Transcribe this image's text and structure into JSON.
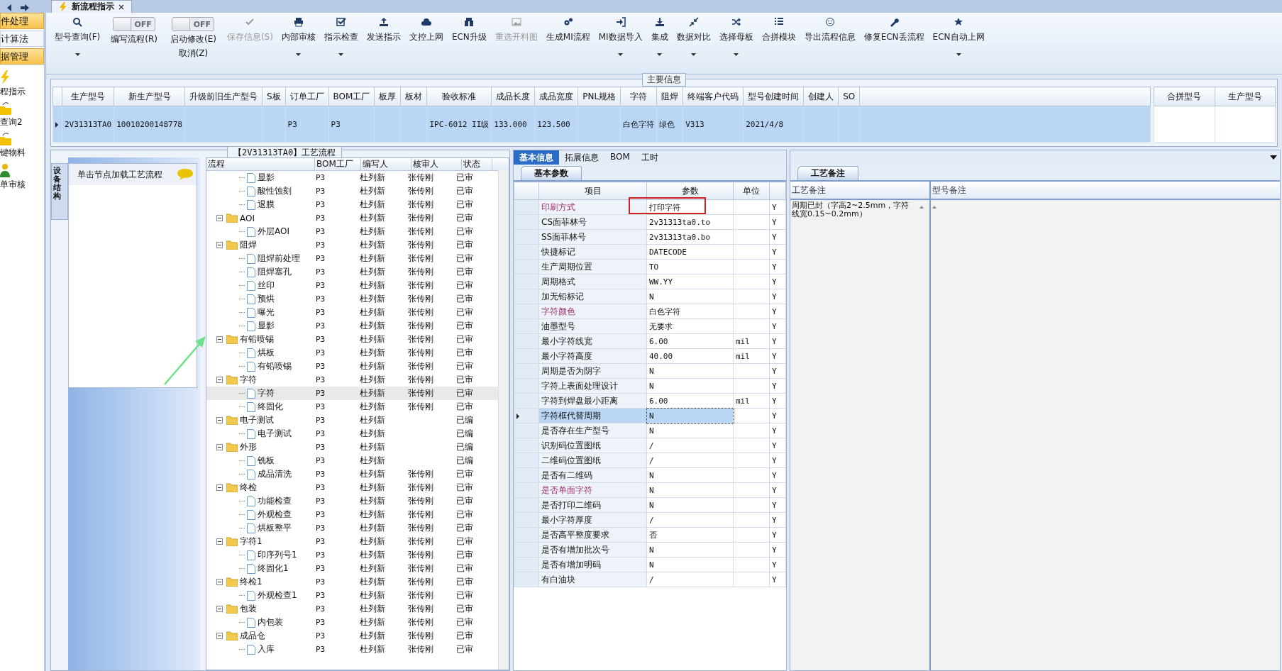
{
  "doc_tab": {
    "title": "新流程指示"
  },
  "sidebar": {
    "items": [
      {
        "label": "件处理",
        "kind": "menu",
        "selected": true
      },
      {
        "label": "计算法",
        "kind": "menu",
        "selected": false
      },
      {
        "label": "据管理",
        "kind": "menu",
        "selected": true
      },
      {
        "label": "程指示",
        "kind": "icon",
        "selected": false
      },
      {
        "label": "查询2",
        "kind": "icon",
        "selected": false
      },
      {
        "label": "键物料",
        "kind": "icon",
        "selected": false
      },
      {
        "label": "单审核",
        "kind": "icon",
        "selected": false
      }
    ]
  },
  "toolbar": [
    {
      "kind": "button",
      "label": "型号查询(F)",
      "dropdown": true,
      "disabled": false
    },
    {
      "kind": "toggle",
      "label": "编写流程(R)",
      "state_text": "OFF",
      "on": false
    },
    {
      "kind": "toggle",
      "label": "启动修改(E)",
      "label2": "取消(Z)",
      "state_text": "OFF",
      "on": false
    },
    {
      "kind": "button",
      "label": "保存信息(S)",
      "dropdown": false,
      "disabled": true
    },
    {
      "kind": "button",
      "label": "内部审核",
      "dropdown": true,
      "disabled": false
    },
    {
      "kind": "button",
      "label": "指示检查",
      "dropdown": true,
      "disabled": false
    },
    {
      "kind": "button",
      "label": "发送指示",
      "dropdown": false,
      "disabled": false
    },
    {
      "kind": "button",
      "label": "文控上网",
      "dropdown": false,
      "disabled": false
    },
    {
      "kind": "button",
      "label": "ECN升级",
      "dropdown": false,
      "disabled": false
    },
    {
      "kind": "button",
      "label": "重选开料图",
      "dropdown": false,
      "disabled": true
    },
    {
      "kind": "button",
      "label": "生成MI流程",
      "dropdown": false,
      "disabled": false
    },
    {
      "kind": "button",
      "label": "MI数据导入",
      "dropdown": true,
      "disabled": false
    },
    {
      "kind": "button",
      "label": "集成",
      "dropdown": true,
      "disabled": false
    },
    {
      "kind": "button",
      "label": "数据对比",
      "dropdown": true,
      "disabled": false
    },
    {
      "kind": "button",
      "label": "选择母板",
      "dropdown": true,
      "disabled": false
    },
    {
      "kind": "button",
      "label": "合拼模块",
      "dropdown": false,
      "disabled": false
    },
    {
      "kind": "button",
      "label": "导出流程信息",
      "dropdown": false,
      "disabled": false
    },
    {
      "kind": "button",
      "label": "修复ECN丢流程",
      "dropdown": false,
      "disabled": false
    },
    {
      "kind": "button",
      "label": "ECN自动上网",
      "dropdown": true,
      "disabled": false
    }
  ],
  "main_info": {
    "title": "主要信息",
    "columns": [
      "生产型号",
      "新生产型号",
      "升级前旧生产型号",
      "S板",
      "订单工厂",
      "BOM工厂",
      "板厚",
      "板材",
      "验收标准",
      "成品长度",
      "成品宽度",
      "PNL规格",
      "字符",
      "阻焊",
      "终端客户代码",
      "型号创建时间",
      "创建人",
      "SO"
    ],
    "rows": [
      {
        "selected": true,
        "cells": [
          "2V31313TA0",
          "10010200148778",
          "",
          "",
          "P3",
          "P3",
          "",
          "",
          "IPC-6012 II级",
          "133.000",
          "123.500",
          "",
          "白色字符",
          "绿色",
          "V313",
          "2021/4/8",
          "",
          ""
        ]
      }
    ],
    "side_columns": [
      "合拼型号",
      "生产型号"
    ]
  },
  "process": {
    "title": "【2V31313TA0】工艺流程",
    "side_tab": "设备结构",
    "hint": "单击节点加载工艺流程",
    "columns": [
      "流程",
      "BOM工厂",
      "编写人",
      "核审人",
      "状态"
    ],
    "tree": [
      {
        "children": [
          {
            "label": "显影",
            "bom": "P3",
            "writer": "杜列新",
            "reviewer": "张传刚",
            "status": "已审",
            "selected": false
          },
          {
            "label": "酸性蚀刻",
            "bom": "P3",
            "writer": "杜列新",
            "reviewer": "张传刚",
            "status": "已审",
            "selected": false
          },
          {
            "label": "退膜",
            "bom": "P3",
            "writer": "杜列新",
            "reviewer": "张传刚",
            "status": "已审",
            "selected": false
          }
        ]
      },
      {
        "label": "AOI",
        "bom": "P3",
        "writer": "杜列新",
        "reviewer": "张传刚",
        "status": "已审",
        "expanded": true,
        "selected": false,
        "children": [
          {
            "label": "外层AOI",
            "bom": "P3",
            "writer": "杜列新",
            "reviewer": "张传刚",
            "status": "已审",
            "selected": false
          }
        ]
      },
      {
        "label": "阻焊",
        "bom": "P3",
        "writer": "杜列新",
        "reviewer": "张传刚",
        "status": "已审",
        "expanded": true,
        "selected": false,
        "children": [
          {
            "label": "阻焊前处理",
            "bom": "P3",
            "writer": "杜列新",
            "reviewer": "张传刚",
            "status": "已审",
            "selected": false
          },
          {
            "label": "阻焊塞孔",
            "bom": "P3",
            "writer": "杜列新",
            "reviewer": "张传刚",
            "status": "已审",
            "selected": false
          },
          {
            "label": "丝印",
            "bom": "P3",
            "writer": "杜列新",
            "reviewer": "张传刚",
            "status": "已审",
            "selected": false
          },
          {
            "label": "预烘",
            "bom": "P3",
            "writer": "杜列新",
            "reviewer": "张传刚",
            "status": "已审",
            "selected": false
          },
          {
            "label": "曝光",
            "bom": "P3",
            "writer": "杜列新",
            "reviewer": "张传刚",
            "status": "已审",
            "selected": false
          },
          {
            "label": "显影",
            "bom": "P3",
            "writer": "杜列新",
            "reviewer": "张传刚",
            "status": "已审",
            "selected": false
          }
        ]
      },
      {
        "label": "有铅喷锡",
        "bom": "P3",
        "writer": "杜列新",
        "reviewer": "张传刚",
        "status": "已审",
        "expanded": true,
        "selected": false,
        "children": [
          {
            "label": "烘板",
            "bom": "P3",
            "writer": "杜列新",
            "reviewer": "张传刚",
            "status": "已审",
            "selected": false
          },
          {
            "label": "有铅喷锡",
            "bom": "P3",
            "writer": "杜列新",
            "reviewer": "张传刚",
            "status": "已审",
            "selected": false
          }
        ]
      },
      {
        "label": "字符",
        "bom": "P3",
        "writer": "杜列新",
        "reviewer": "张传刚",
        "status": "已审",
        "expanded": true,
        "selected": false,
        "children": [
          {
            "label": "字符",
            "bom": "P3",
            "writer": "杜列新",
            "reviewer": "张传刚",
            "status": "已审",
            "selected": true
          },
          {
            "label": "终固化",
            "bom": "P3",
            "writer": "杜列新",
            "reviewer": "张传刚",
            "status": "已审",
            "selected": false
          }
        ]
      },
      {
        "label": "电子测试",
        "bom": "P3",
        "writer": "杜列新",
        "status": "已编",
        "expanded": true,
        "selected": false,
        "children": [
          {
            "label": "电子测试",
            "bom": "P3",
            "writer": "杜列新",
            "status": "已编",
            "selected": false
          }
        ]
      },
      {
        "label": "外形",
        "bom": "P3",
        "writer": "杜列新",
        "status": "已编",
        "expanded": true,
        "selected": false,
        "children": [
          {
            "label": "铣板",
            "bom": "P3",
            "writer": "杜列新",
            "status": "已编",
            "selected": false
          },
          {
            "label": "成品清洗",
            "bom": "P3",
            "writer": "杜列新",
            "reviewer": "张传刚",
            "status": "已审",
            "selected": false
          }
        ]
      },
      {
        "label": "终检",
        "bom": "P3",
        "writer": "杜列新",
        "reviewer": "张传刚",
        "status": "已审",
        "expanded": true,
        "selected": false,
        "children": [
          {
            "label": "功能检查",
            "bom": "P3",
            "writer": "杜列新",
            "reviewer": "张传刚",
            "status": "已审",
            "selected": false
          },
          {
            "label": "外观检查",
            "bom": "P3",
            "writer": "杜列新",
            "reviewer": "张传刚",
            "status": "已审",
            "selected": false
          },
          {
            "label": "烘板整平",
            "bom": "P3",
            "writer": "杜列新",
            "reviewer": "张传刚",
            "status": "已审",
            "selected": false
          }
        ]
      },
      {
        "label": "字符1",
        "bom": "P3",
        "writer": "杜列新",
        "reviewer": "张传刚",
        "status": "已审",
        "expanded": true,
        "selected": false,
        "children": [
          {
            "label": "印序列号1",
            "bom": "P3",
            "writer": "杜列新",
            "reviewer": "张传刚",
            "status": "已审",
            "selected": false
          },
          {
            "label": "终固化1",
            "bom": "P3",
            "writer": "杜列新",
            "reviewer": "张传刚",
            "status": "已审",
            "selected": false
          }
        ]
      },
      {
        "label": "终检1",
        "bom": "P3",
        "writer": "杜列新",
        "reviewer": "张传刚",
        "status": "已审",
        "expanded": true,
        "selected": false,
        "children": [
          {
            "label": "外观检查1",
            "bom": "P3",
            "writer": "杜列新",
            "reviewer": "张传刚",
            "status": "已审",
            "selected": false
          }
        ]
      },
      {
        "label": "包装",
        "bom": "P3",
        "writer": "杜列新",
        "reviewer": "张传刚",
        "status": "已审",
        "expanded": true,
        "selected": false,
        "children": [
          {
            "label": "内包装",
            "bom": "P3",
            "writer": "杜列新",
            "reviewer": "张传刚",
            "status": "已审",
            "selected": false
          }
        ]
      },
      {
        "label": "成品仓",
        "bom": "P3",
        "writer": "杜列新",
        "reviewer": "张传刚",
        "status": "已审",
        "expanded": true,
        "selected": false,
        "children": [
          {
            "label": "入库",
            "bom": "P3",
            "writer": "杜列新",
            "reviewer": "张传刚",
            "status": "已审",
            "selected": false
          }
        ]
      }
    ]
  },
  "detail": {
    "tabs": [
      {
        "label": "基本信息",
        "selected": true
      },
      {
        "label": "拓展信息",
        "selected": false
      },
      {
        "label": "BOM",
        "selected": false
      },
      {
        "label": "工时",
        "selected": false
      }
    ],
    "subtab": "基本参数",
    "columns": [
      "项目",
      "参数",
      "单位"
    ],
    "rows": [
      {
        "item": "印刷方式",
        "value": "打印字符",
        "flag": "Y",
        "emphasis": true,
        "boxed": true,
        "selected": false
      },
      {
        "item": "CS面菲林号",
        "value": "2v31313ta0.to",
        "flag": "Y",
        "emphasis": false,
        "boxed": false,
        "selected": false
      },
      {
        "item": "SS面菲林号",
        "value": "2v31313ta0.bo",
        "flag": "Y",
        "emphasis": false,
        "boxed": false,
        "selected": false
      },
      {
        "item": "快捷标记",
        "value": "DATECODE",
        "flag": "Y",
        "emphasis": false,
        "boxed": false,
        "selected": false
      },
      {
        "item": "生产周期位置",
        "value": "TO",
        "flag": "Y",
        "emphasis": false,
        "boxed": false,
        "selected": false
      },
      {
        "item": "周期格式",
        "value": "WW.YY",
        "flag": "Y",
        "emphasis": false,
        "boxed": false,
        "selected": false
      },
      {
        "item": "加无铅标记",
        "value": "N",
        "flag": "Y",
        "emphasis": false,
        "boxed": false,
        "selected": false
      },
      {
        "item": "字符颜色",
        "value": "白色字符",
        "flag": "Y",
        "emphasis": true,
        "boxed": false,
        "selected": false
      },
      {
        "item": "油墨型号",
        "value": "无要求",
        "flag": "Y",
        "emphasis": false,
        "boxed": false,
        "selected": false
      },
      {
        "item": "最小字符线宽",
        "value": "6.00",
        "unit": "mil",
        "flag": "Y",
        "emphasis": false,
        "boxed": false,
        "selected": false
      },
      {
        "item": "最小字符高度",
        "value": "40.00",
        "unit": "mil",
        "flag": "Y",
        "emphasis": false,
        "boxed": false,
        "selected": false
      },
      {
        "item": "周期是否为阴字",
        "value": "N",
        "flag": "Y",
        "emphasis": false,
        "boxed": false,
        "selected": false
      },
      {
        "item": "字符上表面处理设计",
        "value": "N",
        "flag": "Y",
        "emphasis": false,
        "boxed": false,
        "selected": false
      },
      {
        "item": "字符到焊盘最小距离",
        "value": "6.00",
        "unit": "mil",
        "flag": "Y",
        "emphasis": false,
        "boxed": false,
        "selected": false
      },
      {
        "item": "字符框代替周期",
        "value": "N",
        "flag": "Y",
        "emphasis": false,
        "boxed": false,
        "selected": true
      },
      {
        "item": "是否存在生产型号",
        "value": "N",
        "flag": "Y",
        "emphasis": false,
        "boxed": false,
        "selected": false
      },
      {
        "item": "识别码位置图纸",
        "value": "/",
        "flag": "Y",
        "emphasis": false,
        "boxed": false,
        "selected": false
      },
      {
        "item": "二维码位置图纸",
        "value": "/",
        "flag": "Y",
        "emphasis": false,
        "boxed": false,
        "selected": false
      },
      {
        "item": "是否有二维码",
        "value": "N",
        "flag": "Y",
        "emphasis": false,
        "boxed": false,
        "selected": false
      },
      {
        "item": "是否单面字符",
        "value": "N",
        "flag": "Y",
        "emphasis": true,
        "boxed": false,
        "selected": false
      },
      {
        "item": "是否打印二维码",
        "value": "N",
        "flag": "Y",
        "emphasis": false,
        "boxed": false,
        "selected": false
      },
      {
        "item": "最小字符厚度",
        "value": "/",
        "flag": "Y",
        "emphasis": false,
        "boxed": false,
        "selected": false
      },
      {
        "item": "是否高平整度要求",
        "value": "否",
        "flag": "Y",
        "emphasis": false,
        "boxed": false,
        "selected": false
      },
      {
        "item": "是否有增加批次号",
        "value": "N",
        "flag": "Y",
        "emphasis": false,
        "boxed": false,
        "selected": false
      },
      {
        "item": "是否有增加明码",
        "value": "N",
        "flag": "Y",
        "emphasis": false,
        "boxed": false,
        "selected": false
      },
      {
        "item": "有白油块",
        "value": "/",
        "flag": "Y",
        "emphasis": false,
        "boxed": false,
        "selected": false
      }
    ]
  },
  "remarks": {
    "tab": "工艺备注",
    "columns": [
      "工艺备注",
      "型号备注"
    ],
    "process_note": "周期已封（字高2~2.5mm，字符线宽0.15~0.2mm）"
  }
}
